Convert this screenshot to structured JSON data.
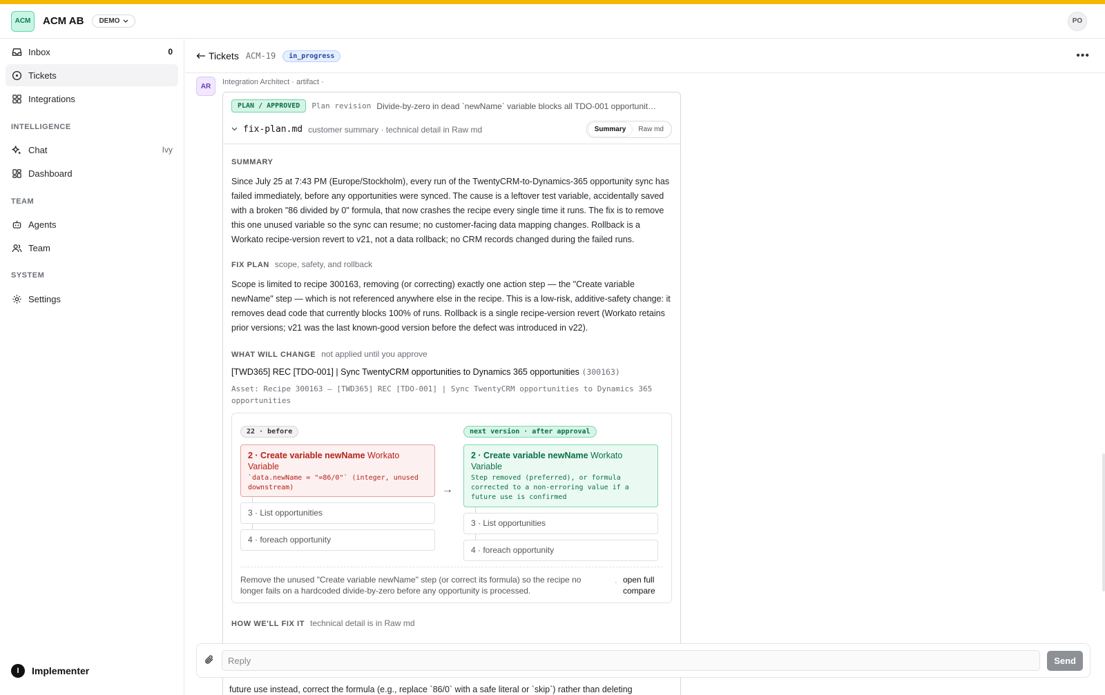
{
  "header": {
    "logo_text": "ACM",
    "org_name": "ACM AB",
    "env_label": "DEMO",
    "user_initials": "PO",
    "accent_color": "#f5b800"
  },
  "sidebar": {
    "items": [
      {
        "label": "Inbox",
        "icon": "inbox-icon",
        "right": "0"
      },
      {
        "label": "Tickets",
        "icon": "ticket-icon",
        "active": true
      },
      {
        "label": "Integrations",
        "icon": "grid-icon"
      }
    ],
    "intelligence": {
      "title": "INTELLIGENCE",
      "items": [
        {
          "label": "Chat",
          "icon": "sparkle-icon",
          "right": "Ivy"
        },
        {
          "label": "Dashboard",
          "icon": "dashboard-icon"
        }
      ]
    },
    "team": {
      "title": "TEAM",
      "items": [
        {
          "label": "Agents",
          "icon": "robot-icon"
        },
        {
          "label": "Team",
          "icon": "users-icon"
        }
      ]
    },
    "system": {
      "title": "SYSTEM",
      "items": [
        {
          "label": "Settings",
          "icon": "gear-icon"
        }
      ]
    },
    "footer_brand": "Implementer",
    "footer_icon_letter": "I"
  },
  "ticket": {
    "back_label": "Tickets",
    "id": "ACM-19",
    "status": "in_progress"
  },
  "message": {
    "avatar": "AR",
    "meta": "Integration Architect · artifact ·",
    "badge": "PLAN / APPROVED",
    "revision_label": "Plan revision",
    "title": "Divide-by-zero in dead `newName` variable blocks all TDO-001 opportunit…",
    "filename": "fix-plan.md",
    "file_desc": "customer summary · technical detail in Raw md",
    "toggle": [
      "Summary",
      "Raw md"
    ],
    "summary_title": "SUMMARY",
    "summary_text": "Since July 25 at 7:43 PM (Europe/Stockholm), every run of the TwentyCRM-to-Dynamics-365 opportunity sync has failed immediately, before any opportunities were synced. The cause is a leftover test variable, accidentally saved with a broken \"86 divided by 0\" formula, that now crashes the recipe every single time it runs. The fix is to remove this one unused variable so the sync can resume; no customer-facing data mapping changes. Rollback is a Workato recipe-version revert to v21, not a data rollback; no CRM records changed during the failed runs.",
    "fixplan_title": "FIX PLAN",
    "fixplan_sub": "scope, safety, and rollback",
    "fixplan_text": "Scope is limited to recipe 300163, removing (or correcting) exactly one action step — the \"Create variable newName\" step — which is not referenced anywhere else in the recipe. This is a low-risk, additive-safety change: it removes dead code that currently blocks 100% of runs. Rollback is a single recipe-version revert (Workato retains prior versions; v21 was the last known-good version before the defect was introduced in v22).",
    "change_title": "WHAT WILL CHANGE",
    "change_sub": "not applied until you approve",
    "recipe_name": "[TWD365] REC [TDO-001] | Sync TwentyCRM opportunities to Dynamics 365 opportunities",
    "recipe_id": "(300163)",
    "asset_line": "Asset: Recipe 300163 — [TWD365] REC [TDO-001] | Sync TwentyCRM opportunities to Dynamics 365 opportunities",
    "diff": {
      "before_pill": "22 · before",
      "after_pill": "next version · after approval",
      "before_step_bold": "2 · Create variable newName",
      "before_step_rest": " Workato Variable",
      "before_detail": "`data.newName = \"=86/0\"` (integer, unused downstream)",
      "after_step_bold": "2 · Create variable newName",
      "after_step_rest": " Workato Variable",
      "after_detail": "Step removed (preferred), or formula corrected to a non-erroring value if a future use is confirmed",
      "step3": "3 · List opportunities",
      "step4": "4 · foreach opportunity",
      "arrow": "→",
      "footer_desc": "Remove the unused \"Create variable newName\" step (or correct its formula) so the recipe no longer fails on a hardcoded divide-by-zero before any opportunity is processed.",
      "footer_dot": "·",
      "footer_link": "open full compare"
    },
    "howfix_title": "HOW WE'LL FIX IT",
    "howfix_sub": "technical detail is in Raw md",
    "overflow_line": "future use instead, correct the formula (e.g., replace `86/0` with a safe literal or `skip`) rather than deleting"
  },
  "reply": {
    "placeholder": "Reply",
    "send_label": "Send"
  }
}
